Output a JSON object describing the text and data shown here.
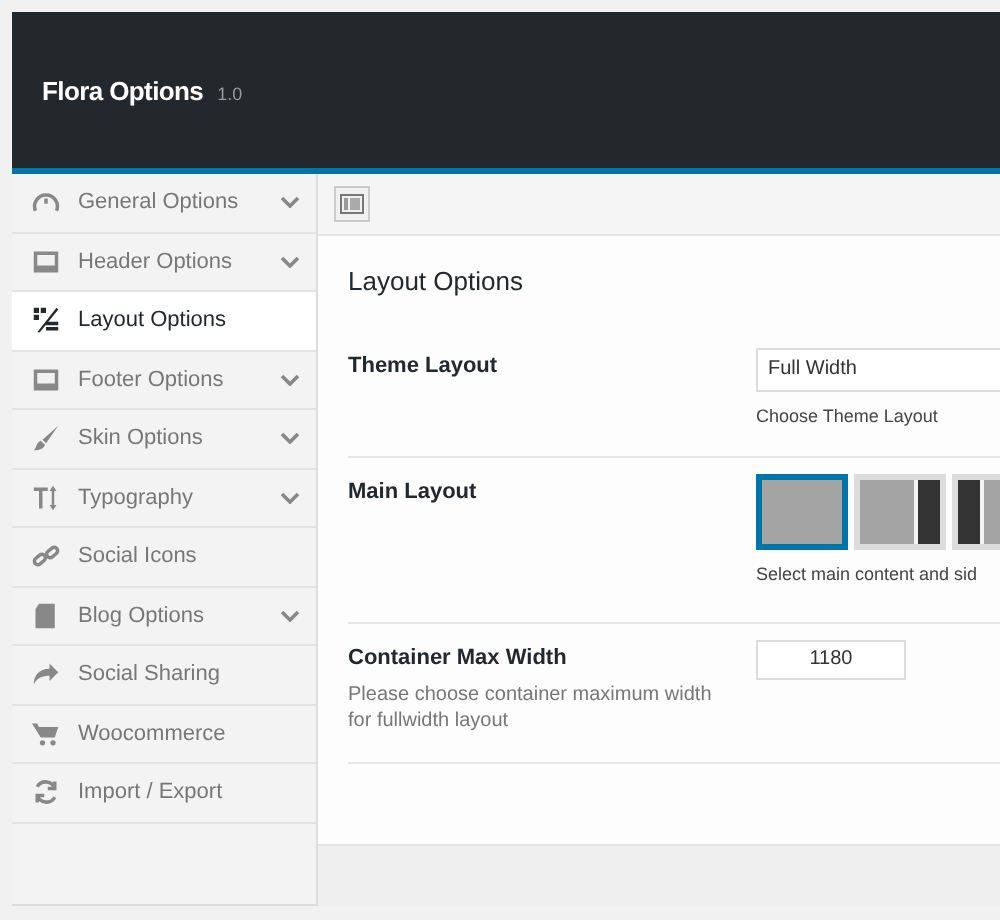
{
  "header": {
    "title": "Flora Options",
    "version": "1.0"
  },
  "sidebar": {
    "items": [
      {
        "label": "General Options",
        "selected": false,
        "expandable": true
      },
      {
        "label": "Header Options",
        "selected": false,
        "expandable": true
      },
      {
        "label": "Layout Options",
        "selected": true,
        "expandable": false
      },
      {
        "label": "Footer Options",
        "selected": false,
        "expandable": true
      },
      {
        "label": "Skin Options",
        "selected": false,
        "expandable": true
      },
      {
        "label": "Typography",
        "selected": false,
        "expandable": true
      },
      {
        "label": "Social Icons",
        "selected": false,
        "expandable": false
      },
      {
        "label": "Blog Options",
        "selected": false,
        "expandable": true
      },
      {
        "label": "Social Sharing",
        "selected": false,
        "expandable": false
      },
      {
        "label": "Woocommerce",
        "selected": false,
        "expandable": false
      },
      {
        "label": "Import / Export",
        "selected": false,
        "expandable": false
      }
    ]
  },
  "section": {
    "title": "Layout Options",
    "fields": [
      {
        "kind": "select",
        "label": "Theme Layout",
        "value": "Full Width",
        "help": "Choose Theme Layout"
      },
      {
        "kind": "images",
        "label": "Main Layout",
        "options": [
          {
            "selected": true
          },
          {
            "selected": false
          },
          {
            "selected": false
          }
        ],
        "help": "Select main content and sid"
      },
      {
        "kind": "text",
        "label": "Container Max Width",
        "description": "Please choose container maximum width for fullwidth layout",
        "value": "1180"
      }
    ]
  }
}
